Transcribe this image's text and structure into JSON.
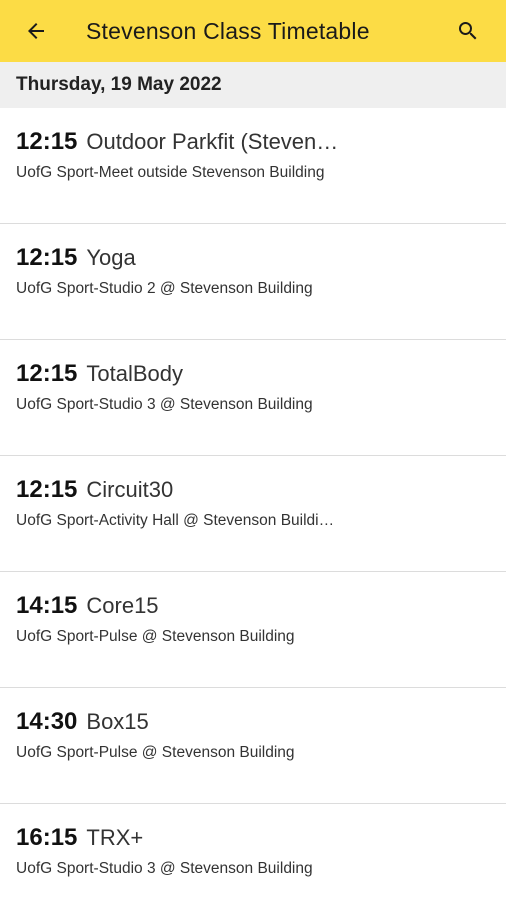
{
  "appbar": {
    "title": "Stevenson Class Timetable",
    "back_icon": "arrow-left-icon",
    "search_icon": "search-icon",
    "background_color": "#fcdc45"
  },
  "date_header": "Thursday, 19 May 2022",
  "classes": [
    {
      "time": "12:15",
      "name": "Outdoor Parkfit (Steven…",
      "location": "UofG Sport-Meet outside Stevenson Building"
    },
    {
      "time": "12:15",
      "name": "Yoga",
      "location": "UofG Sport-Studio 2 @ Stevenson Building"
    },
    {
      "time": "12:15",
      "name": "TotalBody",
      "location": "UofG Sport-Studio 3 @ Stevenson Building"
    },
    {
      "time": "12:15",
      "name": "Circuit30",
      "location": "UofG Sport-Activity Hall @ Stevenson Buildi…"
    },
    {
      "time": "14:15",
      "name": "Core15",
      "location": "UofG Sport-Pulse @ Stevenson Building"
    },
    {
      "time": "14:30",
      "name": "Box15",
      "location": "UofG Sport-Pulse @ Stevenson Building"
    },
    {
      "time": "16:15",
      "name": "TRX+",
      "location": "UofG Sport-Studio 3 @ Stevenson Building"
    }
  ]
}
